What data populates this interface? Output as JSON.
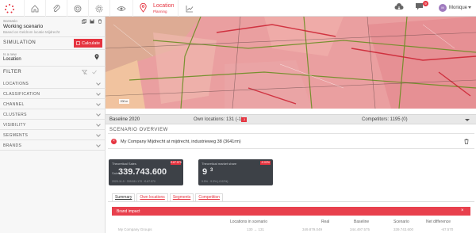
{
  "nav": {
    "active_title": "Location",
    "active_subtitle": "Planning",
    "notification_count": "9",
    "avatar_initials": "M",
    "user_name": "Monique"
  },
  "sidebar": {
    "scenario_label": "Scenario",
    "scenario_title": "Working scenario",
    "scenario_based_on": "Based on Geldrom locatie Mijdrecht",
    "simulation_heading": "SIMULATION",
    "calculate_label": "Calculate",
    "location_small_label": "Is a new",
    "location_label": "Location",
    "filter_heading": "FILTER",
    "sections": [
      "LOCATIONS",
      "CLASSIFICATION",
      "CHANNEL",
      "CLUSTERS",
      "VISIBILITY",
      "SEGMENTS",
      "BRANDS"
    ]
  },
  "map": {
    "scale_label": "200 m"
  },
  "baseline": {
    "name": "Baseline 2020",
    "own_locations": "Own locations: 131 (-1)",
    "own_delta_chip": "-1",
    "competitors": "Competitors: 1195 (0)"
  },
  "overview": {
    "title": "SCENARIO OVERVIEW",
    "row_text": "My Company Mijdrecht at mijdrecht, industrieweg 38 (3641rm)"
  },
  "kpis": [
    {
      "tag": "Theoretical Sales",
      "badge": "€-67.570",
      "prefix": "Sales",
      "value": "339.743.600",
      "foot": "2020-11-9 · 339.811.170 · €-67.570"
    },
    {
      "tag": "Theoretical market share",
      "badge": "-0.02%",
      "value": "9",
      "pct": "% ",
      "pct_value": "3",
      "foot": "9.5% · 9.3% (-0.02%)"
    }
  ],
  "tabs": [
    "Summary",
    "Own locations",
    "Segments",
    "Competition"
  ],
  "brand_bar": {
    "label": "Brand impact",
    "close": "×"
  },
  "table_headers": [
    "Locations in scenario",
    "Real",
    "Baseline",
    "Scenario",
    "Net difference"
  ],
  "first_row": [
    "My Company Groups",
    "130 → 131",
    "349.879.049",
    "344.497.575",
    "339.743.600",
    "-67.570"
  ],
  "colors": {
    "accent": "#e5333f",
    "card_bg": "#3d4147",
    "map_bg": "#ea9fa0"
  }
}
